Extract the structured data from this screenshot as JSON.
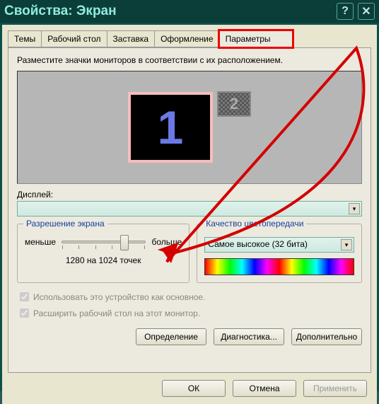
{
  "title": "Свойства: Экран",
  "tabs": [
    "Темы",
    "Рабочий стол",
    "Заставка",
    "Оформление",
    "Параметры"
  ],
  "activeTab": 4,
  "instruction": "Разместите значки мониторов в соответствии с их расположением.",
  "monitors": {
    "primary": "1",
    "secondary": "2"
  },
  "display": {
    "label": "Дисплей:",
    "value": ""
  },
  "resolution": {
    "legend": "Разрешение экрана",
    "less": "меньше",
    "more": "больше",
    "current": "1280 на 1024 точек"
  },
  "quality": {
    "legend": "Качество цветопередачи",
    "value": "Самое высокое (32 бита)"
  },
  "checks": {
    "primary": "Использовать это устройство как основное.",
    "extend": "Расширить рабочий стол на этот монитор."
  },
  "buttons": {
    "identify": "Определение",
    "diagnose": "Диагностика...",
    "advanced": "Дополнительно"
  },
  "footer": {
    "ok": "ОК",
    "cancel": "Отмена",
    "apply": "Применить"
  }
}
